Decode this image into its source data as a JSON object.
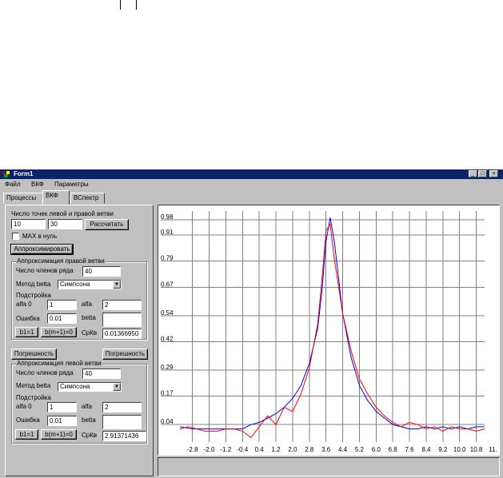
{
  "window": {
    "title": "Form1",
    "minimize_glyph": "_",
    "maximize_glyph": "□",
    "close_glyph": "×"
  },
  "menu": [
    "Файл",
    "ВКФ",
    "Параметры"
  ],
  "tabs": [
    "Процессы",
    "ВКФ",
    "ВСпектр"
  ],
  "panel": {
    "points_label": "Число точек левой и правой ветви",
    "left_points": "10",
    "right_points": "30",
    "calc_button": "Рассчитать",
    "max_zero_label": "MAX в нуль",
    "approx_button": "Аппроксимировать",
    "right_branch": {
      "title": "Аппроксимация правой ветви",
      "terms_label": "Число членов ряда",
      "terms_value": "40",
      "method_label": "Метод betta",
      "method_value": "Симпсона",
      "tuning_label": "Подстройка",
      "alfa0_label": "alfa 0",
      "alfa0_value": "1",
      "alfa_label": "alfa",
      "alfa_value": "2",
      "error_label": "Ошибка",
      "error_value": "0.01",
      "betta_label": "betta",
      "betta_value": "",
      "b1_button": "b1=1",
      "bm_button": "b(m+1)=0",
      "srkv_label": "СрКв",
      "srkv_value": "0.01366950"
    },
    "error_button_left": "Погрешность",
    "error_button_right": "Погрешность",
    "left_branch": {
      "title": "Аппроксимация левой ветви",
      "terms_label": "Число членов ряда",
      "terms_value": "40",
      "method_label": "Метод betta",
      "method_value": "Симпсона",
      "tuning_label": "Подстройка",
      "alfa0_label": "alfa 0",
      "alfa0_value": "1",
      "alfa_label": "alfa",
      "alfa_value": "2",
      "error_label": "Ошибка",
      "error_value": "0.01",
      "betta_label": "betta",
      "betta_value": "",
      "b1_button": "b1=1",
      "bm_button": "b(m+1)=0",
      "srkv_label": "СрКв",
      "srkv_value": "2.91371436"
    }
  },
  "icons": {
    "combo_arrow": "chevron-down-icon",
    "app": "app-icon"
  },
  "chart_data": {
    "type": "line",
    "grid": true,
    "xlim": [
      -3.4,
      11.2
    ],
    "ylim": [
      -0.04,
      1.02
    ],
    "y_ticks": [
      0.04,
      0.17,
      0.29,
      0.42,
      0.54,
      0.67,
      0.79,
      0.91,
      0.98
    ],
    "y_tick_labels": [
      "0.04",
      "0.17",
      "0.29",
      "0.42",
      "0.54",
      "0.67",
      "0.79",
      "0.91",
      "0.98"
    ],
    "x_ticks": [
      -2.8,
      -2.0,
      -1.2,
      -0.4,
      0.4,
      1.2,
      2.0,
      2.8,
      3.6,
      4.4,
      5.2,
      6.0,
      6.8,
      7.6,
      8.4,
      9.2,
      10.0,
      10.8,
      11.6
    ],
    "x_tick_labels": [
      "-2.8",
      "-2.0",
      "-1.2",
      "-0.4",
      "0.4",
      "1.2",
      "2.0",
      "2.8",
      "3.6",
      "4.4",
      "5.2",
      "6.0",
      "6.8",
      "7.6",
      "8.4",
      "9.2",
      "10.0",
      "10.8",
      "11."
    ],
    "series": [
      {
        "color": "#0000ff",
        "x": [
          -3.4,
          -2.8,
          -2.0,
          -1.2,
          -0.4,
          0.0,
          0.4,
          0.8,
          1.2,
          1.6,
          2.0,
          2.4,
          2.8,
          3.2,
          3.4,
          3.6,
          3.8,
          4.0,
          4.4,
          4.8,
          5.2,
          5.6,
          6.0,
          6.4,
          6.8,
          7.2,
          7.6,
          8.0,
          8.4,
          8.8,
          9.2,
          9.6,
          10.0,
          10.4,
          10.8,
          11.2
        ],
        "y": [
          0.03,
          0.02,
          0.02,
          0.02,
          0.02,
          0.04,
          0.05,
          0.07,
          0.09,
          0.12,
          0.16,
          0.22,
          0.32,
          0.48,
          0.65,
          0.88,
          0.99,
          0.88,
          0.55,
          0.35,
          0.22,
          0.15,
          0.1,
          0.07,
          0.04,
          0.03,
          0.02,
          0.02,
          0.03,
          0.02,
          0.03,
          0.02,
          0.03,
          0.02,
          0.03,
          0.03
        ]
      },
      {
        "color": "#ff0000",
        "x": [
          -3.4,
          -3.0,
          -2.6,
          -2.2,
          -1.6,
          -1.2,
          -0.8,
          -0.4,
          0.0,
          0.4,
          0.8,
          1.2,
          1.6,
          2.0,
          2.4,
          2.8,
          3.2,
          3.4,
          3.6,
          3.8,
          4.0,
          4.4,
          4.8,
          5.2,
          5.6,
          6.0,
          6.4,
          6.8,
          7.2,
          7.6,
          8.0,
          8.4,
          8.8,
          9.2,
          9.6,
          10.0,
          10.4,
          10.8,
          11.2
        ],
        "y": [
          0.02,
          0.03,
          0.02,
          0.01,
          0.01,
          0.02,
          0.02,
          0.01,
          -0.02,
          0.03,
          0.08,
          0.04,
          0.12,
          0.1,
          0.18,
          0.3,
          0.5,
          0.7,
          0.93,
          0.96,
          0.8,
          0.55,
          0.38,
          0.25,
          0.18,
          0.12,
          0.08,
          0.05,
          0.03,
          0.05,
          0.04,
          0.02,
          0.03,
          0.01,
          0.03,
          0.02,
          0.02,
          0.01,
          0.02
        ]
      }
    ]
  }
}
